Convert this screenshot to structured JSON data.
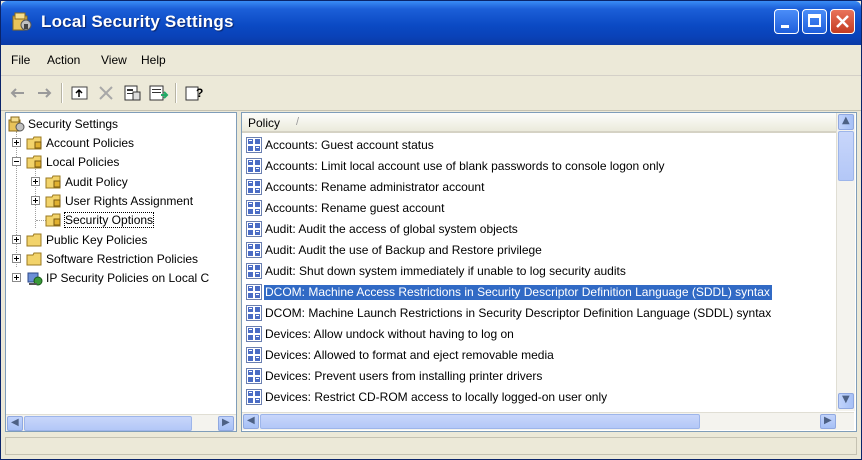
{
  "window": {
    "title": "Local Security Settings"
  },
  "menu": {
    "items": [
      "File",
      "Action",
      "View",
      "Help"
    ]
  },
  "toolbar": {
    "buttons": [
      {
        "icon": "back-arrow-icon"
      },
      {
        "icon": "forward-arrow-icon"
      },
      {
        "icon": "up-folder-icon"
      },
      {
        "icon": "delete-x-icon"
      },
      {
        "icon": "properties-icon"
      },
      {
        "icon": "export-list-icon"
      },
      {
        "icon": "help-icon"
      }
    ]
  },
  "tree": {
    "root": "Security Settings",
    "items": [
      {
        "label": "Account Policies"
      },
      {
        "label": "Local Policies"
      },
      {
        "label": "Audit Policy"
      },
      {
        "label": "User Rights Assignment"
      },
      {
        "label": "Security Options"
      },
      {
        "label": "Public Key Policies"
      },
      {
        "label": "Software Restriction Policies"
      },
      {
        "label": "IP Security Policies on Local C"
      }
    ],
    "selected": "Security Options"
  },
  "list": {
    "column_header": "Policy",
    "sort_indicator": "/",
    "rows": [
      "Accounts: Guest account status",
      "Accounts: Limit local account use of blank passwords to console logon only",
      "Accounts: Rename administrator account",
      "Accounts: Rename guest account",
      "Audit: Audit the access of global system objects",
      "Audit: Audit the use of Backup and Restore privilege",
      "Audit: Shut down system immediately if unable to log security audits",
      "DCOM: Machine Access Restrictions in Security Descriptor Definition Language (SDDL) syntax",
      "DCOM: Machine Launch Restrictions in Security Descriptor Definition Language (SDDL) syntax",
      "Devices: Allow undock without having to log on",
      "Devices: Allowed to format and eject removable media",
      "Devices: Prevent users from installing printer drivers",
      "Devices: Restrict CD-ROM access to locally logged-on user only"
    ],
    "selected_row": "DCOM: Machine Access Restrictions in Security Descriptor Definition Language (SDDL) syntax"
  },
  "colors": {
    "titlebar": "#0b4ac4",
    "selection": "#316ac5",
    "window_bg": "#ece9d8"
  }
}
